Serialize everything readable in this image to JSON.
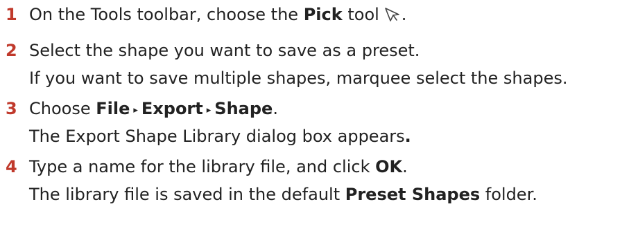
{
  "steps": [
    {
      "number": "1",
      "text_before": "On the Tools toolbar, choose the ",
      "bold": "Pick",
      "text_after": " tool",
      "icon": "pick-tool-arrow-icon",
      "end": "."
    },
    {
      "number": "2",
      "text": "Select the shape you want to save as a preset.",
      "note": "If you want to save multiple shapes, marquee select the shapes."
    },
    {
      "number": "3",
      "text_before": "Choose ",
      "menu": [
        "File",
        "Export",
        "Shape"
      ],
      "menu_separator": "▸",
      "end": ".",
      "note_before": "The Export Shape Library dialog box appears",
      "note_end": "."
    },
    {
      "number": "4",
      "text_before": "Type a name for the library file, and click ",
      "bold": "OK",
      "end": ".",
      "note_before": "The library file is saved in the default ",
      "note_bold": "Preset Shapes",
      "note_after": " folder."
    }
  ],
  "colors": {
    "number": "#c0392b",
    "text": "#222222"
  }
}
